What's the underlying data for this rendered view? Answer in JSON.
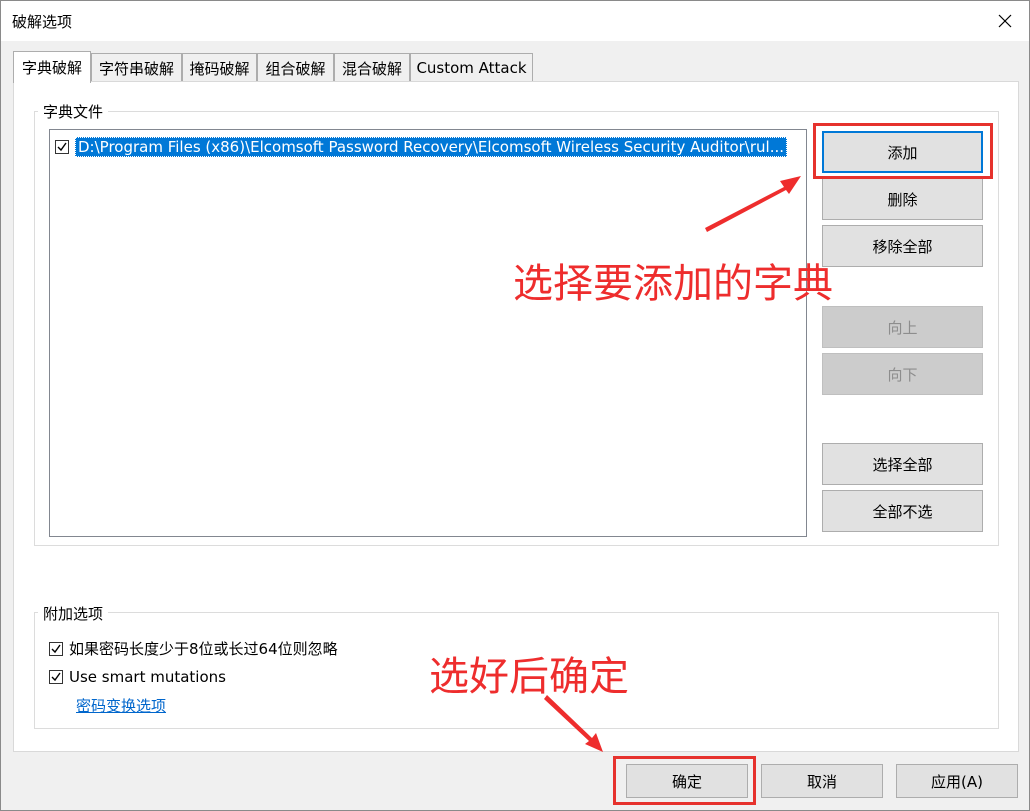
{
  "window": {
    "title": "破解选项"
  },
  "tabs": [
    {
      "label": "字典破解",
      "active": true
    },
    {
      "label": "字符串破解"
    },
    {
      "label": "掩码破解"
    },
    {
      "label": "组合破解"
    },
    {
      "label": "混合破解"
    },
    {
      "label": "Custom Attack"
    }
  ],
  "dictionary": {
    "group_label": "字典文件",
    "files": [
      {
        "checked": true,
        "path": "D:\\Program Files (x86)\\Elcomsoft Password Recovery\\Elcomsoft Wireless Security Auditor\\rul..."
      }
    ],
    "buttons": {
      "add": "添加",
      "delete": "删除",
      "remove_all": "移除全部",
      "move_up": "向上",
      "move_down": "向下",
      "select_all": "选择全部",
      "select_none": "全部不选"
    }
  },
  "extra": {
    "group_label": "附加选项",
    "ignore_length": {
      "checked": true,
      "label": "如果密码长度少于8位或长过64位则忽略"
    },
    "smart_mutations": {
      "checked": true,
      "label": "Use smart mutations"
    },
    "mutation_link": "密码变换选项"
  },
  "footer": {
    "ok": "确定",
    "cancel": "取消",
    "apply": "应用(A)"
  },
  "annotations": {
    "choose_dict": "选择要添加的字典",
    "confirm": "选好后确定",
    "color": "#ee2d2d"
  },
  "colors": {
    "selection": "#0078d7",
    "focus": "#0078d7"
  }
}
